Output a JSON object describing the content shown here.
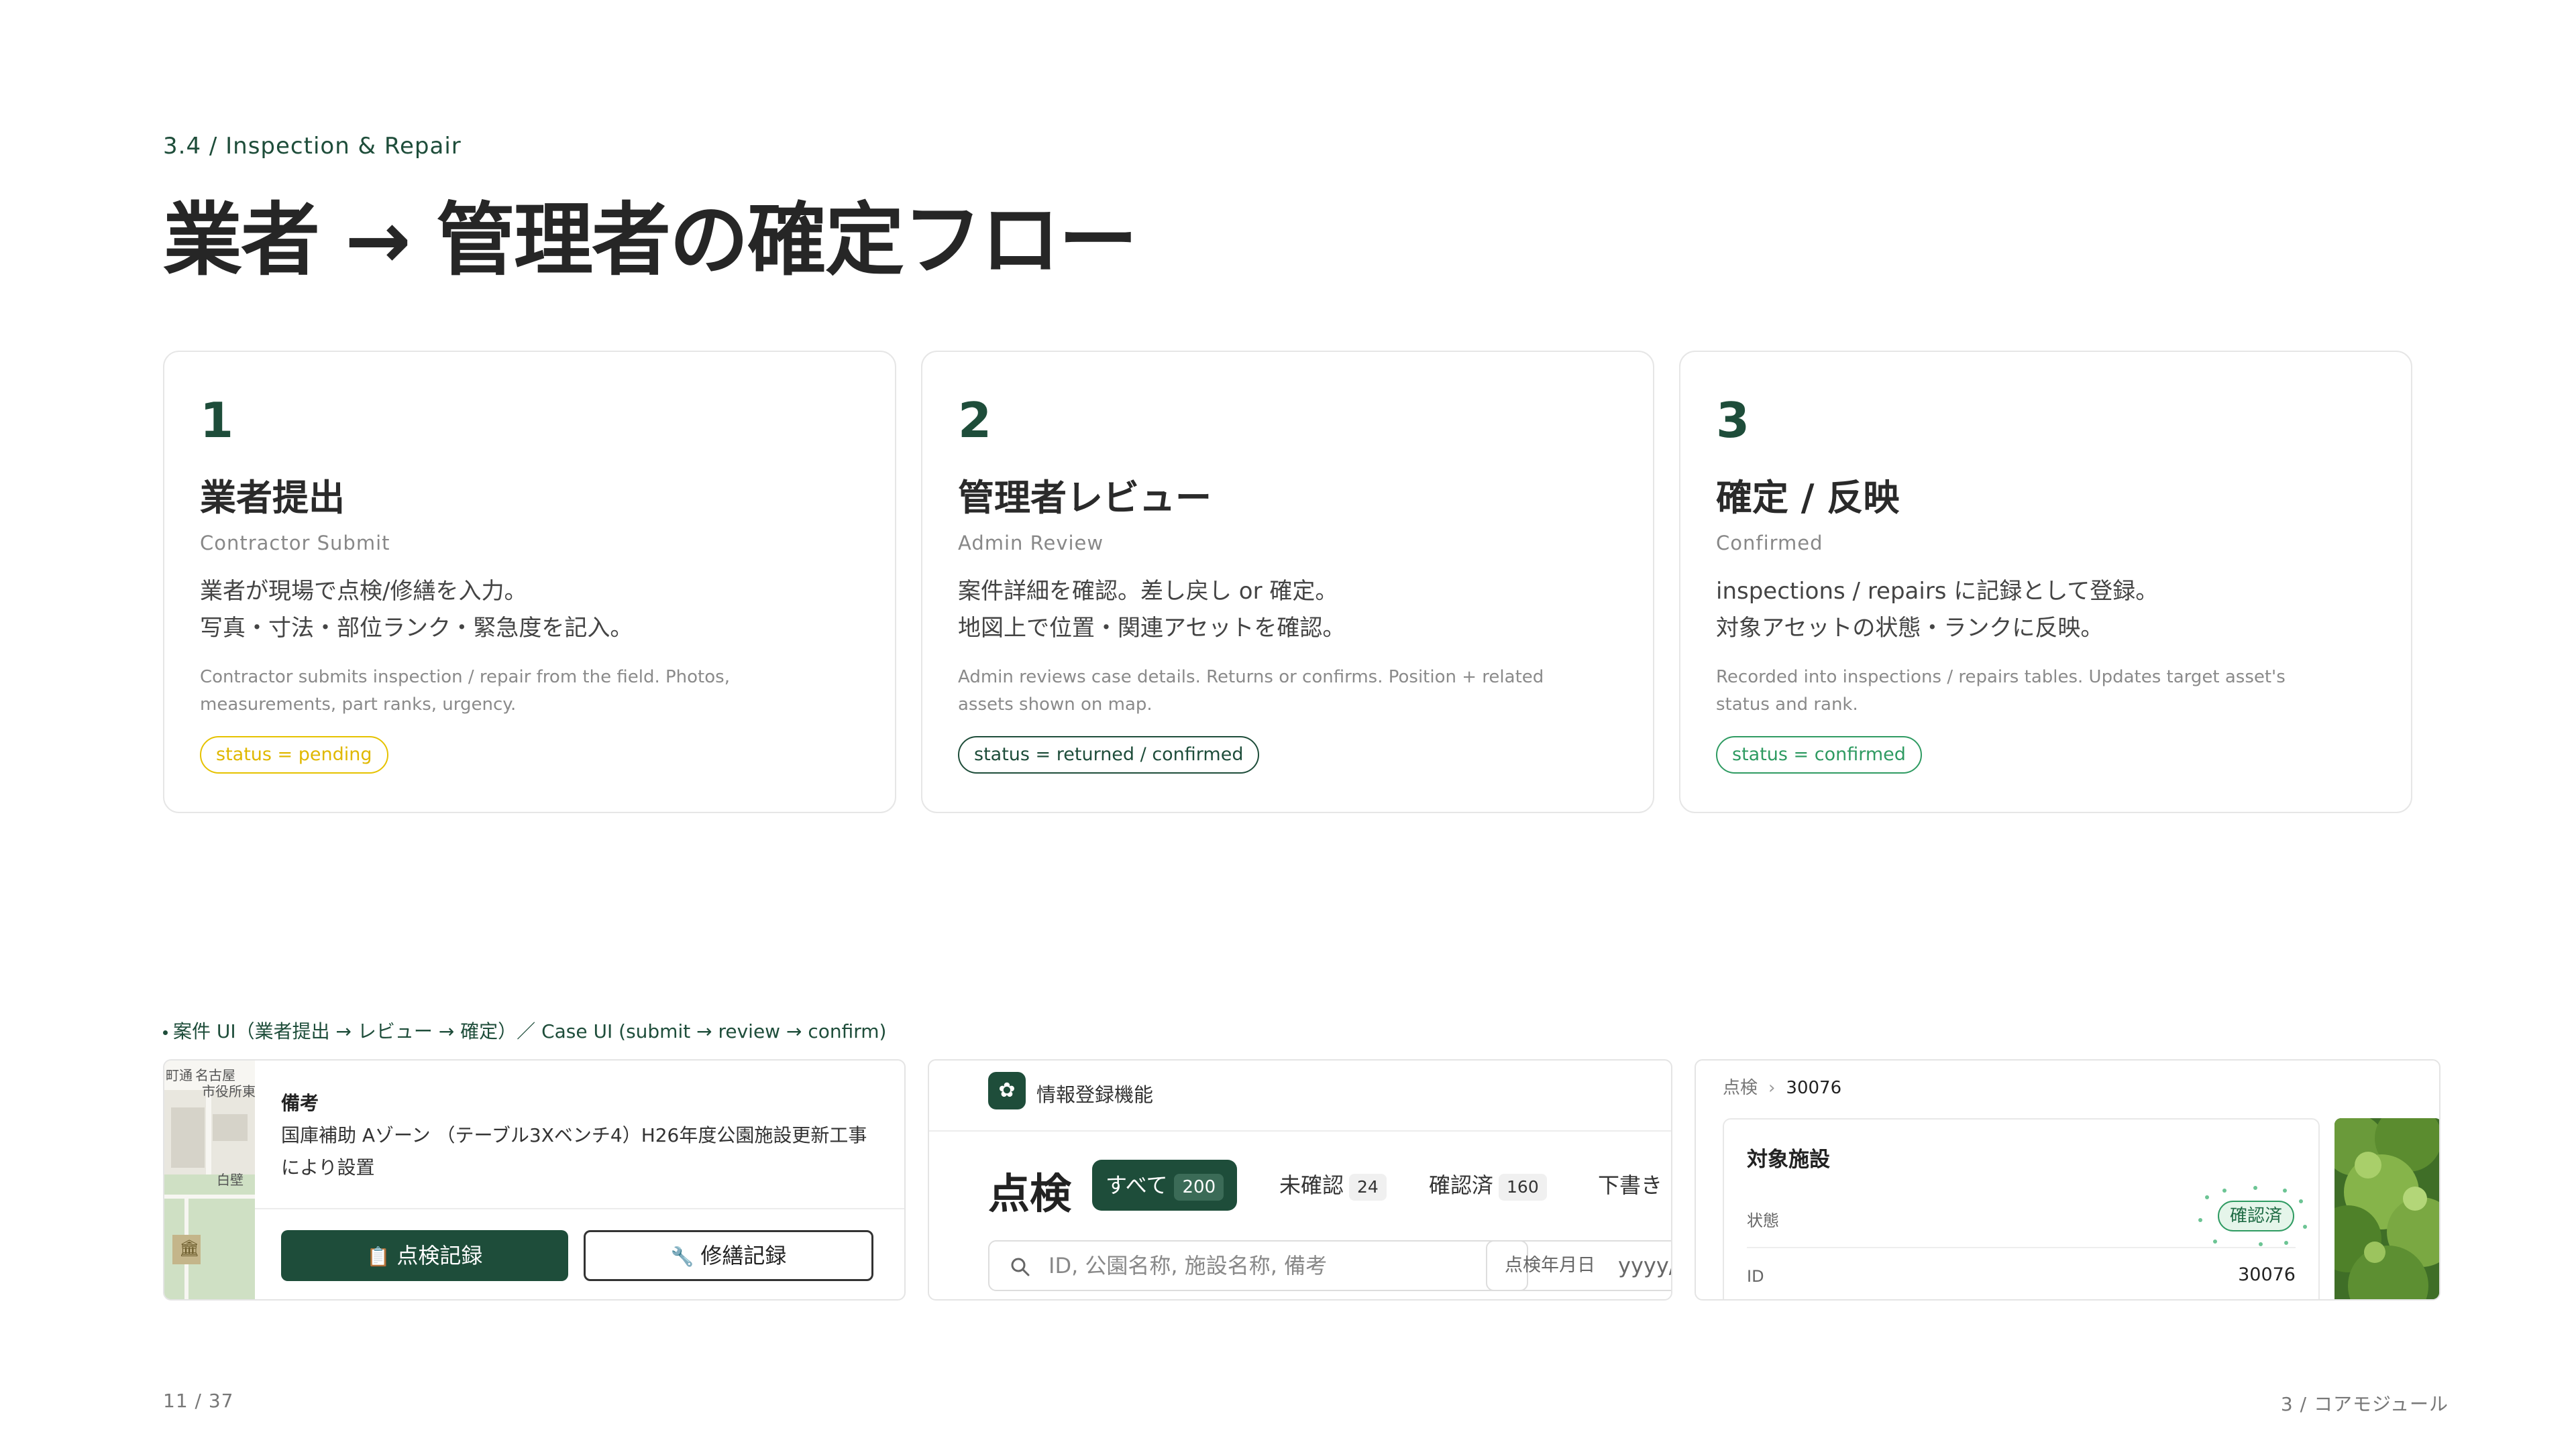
{
  "header": {
    "eyebrow": "3.4 / Inspection & Repair",
    "title": "業者 → 管理者の確定フロー"
  },
  "steps": [
    {
      "number": "1",
      "title": "業者提出",
      "subtitle": "Contractor Submit",
      "desc_line1": "業者が現場で点検/修繕を入力。",
      "desc_line2": "写真・寸法・部位ランク・緊急度を記入。",
      "desc_en": "Contractor submits inspection / repair from the field. Photos, measurements, part ranks, urgency.",
      "status": "status = pending",
      "status_color": "#e6c200"
    },
    {
      "number": "2",
      "title": "管理者レビュー",
      "subtitle": "Admin Review",
      "desc_line1": "案件詳細を確認。差し戻し or 確定。",
      "desc_line2": "地図上で位置・関連アセットを確認。",
      "desc_en": "Admin reviews case details. Returns or confirms. Position + related assets shown on map.",
      "status": "status = returned / confirmed",
      "status_color": "#1e4d3a"
    },
    {
      "number": "3",
      "title": "確定 / 反映",
      "subtitle": "Confirmed",
      "desc_line1": "inspections / repairs に記録として登録。",
      "desc_line2": "対象アセットの状態・ランクに反映。",
      "desc_en": "Recorded into inspections / repairs tables. Updates target asset's status and rank.",
      "status": "status = confirmed",
      "status_color": "#2f9b62"
    }
  ],
  "caption": "案件 UI（業者提出 → レビュー → 確定）／ Case UI (submit → review → confirm)",
  "shot1": {
    "map_labels": [
      "町通",
      "名古屋",
      "市役所東",
      "白壁"
    ],
    "label": "備考",
    "text": "国庫補助 Aゾーン （テーブル3Xベンチ4）H26年度公園施設更新工事により設置",
    "btn_inspection": "点検記録",
    "btn_repair": "修繕記録"
  },
  "shot2": {
    "app_name": "情報登録機能",
    "title": "点検",
    "tab_all": "すべて",
    "tab_all_count": "200",
    "tab_unconfirmed": "未確認",
    "tab_unconfirmed_count": "24",
    "tab_confirmed": "確認済",
    "tab_confirmed_count": "160",
    "tab_draft": "下書き",
    "search_placeholder": "ID, 公園名称, 施設名称, 備考",
    "date_label": "点検年月日",
    "date_placeholder": "yyyy/"
  },
  "shot3": {
    "crumb_parent": "点検",
    "crumb_current": "30076",
    "card_title": "対象施設",
    "status_key": "状態",
    "status_value": "確認済",
    "id_key": "ID",
    "id_value": "30076"
  },
  "footer": {
    "page": "11 / 37",
    "section": "3 / コアモジュール"
  }
}
